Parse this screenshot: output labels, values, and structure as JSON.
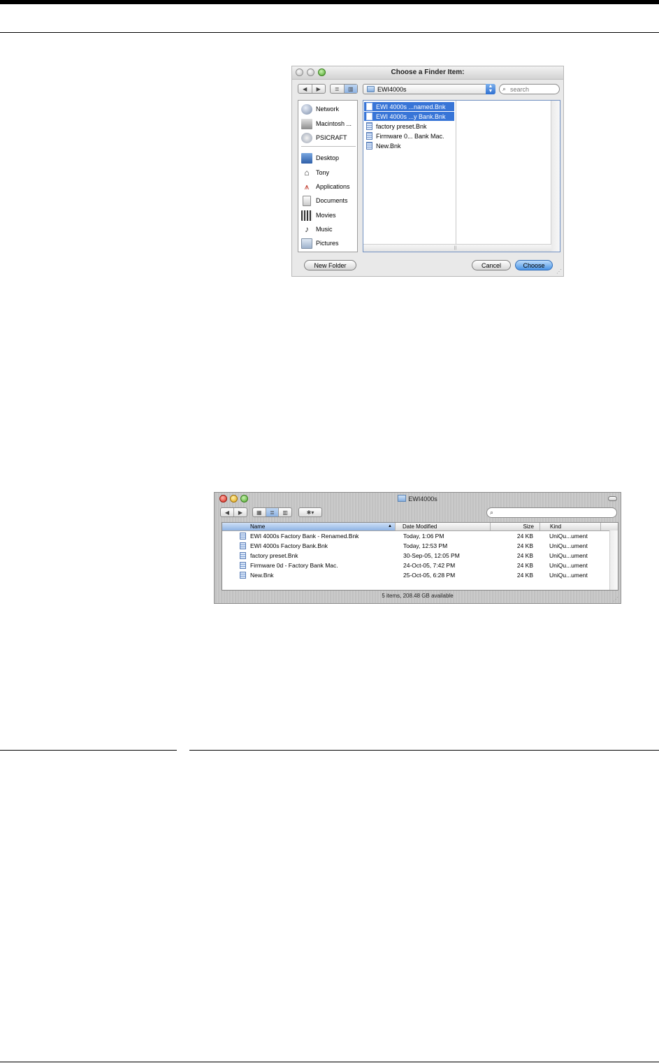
{
  "dialog": {
    "title": "Choose a Finder Item:",
    "nav": {
      "back": "◀",
      "forward": "▶"
    },
    "views": {
      "list": "≣",
      "columns": "▥"
    },
    "location": "EWI4000s",
    "search_placeholder": "search",
    "sidebar": {
      "devices": [
        {
          "label": "Network",
          "icon": "globe-icon"
        },
        {
          "label": "Macintosh ...",
          "icon": "harddisk-icon"
        },
        {
          "label": "PSICRAFT",
          "icon": "disk-icon"
        }
      ],
      "places": [
        {
          "label": "Desktop",
          "icon": "desktop-icon"
        },
        {
          "label": "Tony",
          "icon": "home-icon"
        },
        {
          "label": "Applications",
          "icon": "applications-icon"
        },
        {
          "label": "Documents",
          "icon": "documents-icon"
        },
        {
          "label": "Movies",
          "icon": "movies-icon"
        },
        {
          "label": "Music",
          "icon": "music-icon"
        },
        {
          "label": "Pictures",
          "icon": "pictures-icon"
        }
      ]
    },
    "files": [
      {
        "label": "EWI 4000s ...named.Bnk",
        "selected": true
      },
      {
        "label": "EWI 4000s ...y Bank.Bnk",
        "selected": true
      },
      {
        "label": "factory preset.Bnk",
        "selected": false
      },
      {
        "label": "Firmware 0... Bank Mac.",
        "selected": false
      },
      {
        "label": "New.Bnk",
        "selected": false
      }
    ],
    "buttons": {
      "new_folder": "New Folder",
      "cancel": "Cancel",
      "choose": "Choose"
    }
  },
  "finder": {
    "title": "EWI4000s",
    "nav": {
      "back": "◀",
      "forward": "▶"
    },
    "views": {
      "icon": "▦",
      "list": "≣",
      "columns": "▥"
    },
    "action": "✱▾",
    "columns": {
      "name": "Name",
      "date": "Date Modified",
      "size": "Size",
      "kind": "Kind"
    },
    "rows": [
      {
        "name": "EWI 4000s Factory Bank - Renamed.Bnk",
        "date": "Today, 1:06 PM",
        "size": "24 KB",
        "kind": "UniQu...ument"
      },
      {
        "name": "EWI 4000s Factory Bank.Bnk",
        "date": "Today, 12:53 PM",
        "size": "24 KB",
        "kind": "UniQu...ument"
      },
      {
        "name": "factory preset.Bnk",
        "date": "30-Sep-05, 12:05 PM",
        "size": "24 KB",
        "kind": "UniQu...ument"
      },
      {
        "name": "Firmware 0d - Factory Bank Mac.",
        "date": "24-Oct-05, 7:42 PM",
        "size": "24 KB",
        "kind": "UniQu...ument"
      },
      {
        "name": "New.Bnk",
        "date": "25-Oct-05, 6:28 PM",
        "size": "24 KB",
        "kind": "UniQu...ument"
      }
    ],
    "status": "5 items, 208.48 GB available"
  },
  "colors": {
    "selection": "#3875d7",
    "accent": "#4a94e6"
  }
}
